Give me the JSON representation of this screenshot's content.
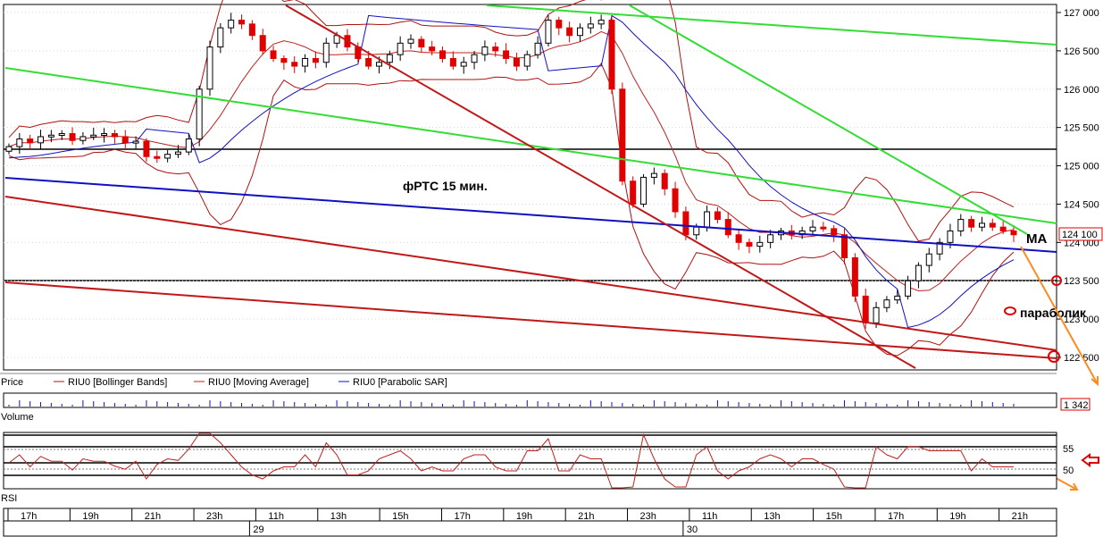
{
  "chart_data": {
    "type": "candlestick",
    "title": "фРТС   15 мин.",
    "instrument": "RIU0",
    "price_axis": {
      "ticks": [
        "127 000",
        "126 500",
        "126 000",
        "125 500",
        "125 000",
        "124 500",
        "124 000",
        "123 500",
        "123 000",
        "122 500"
      ],
      "ylim": [
        122350,
        127080
      ],
      "current_price": 124100,
      "current_price_label": "124 100"
    },
    "time_axis": {
      "hour_labels": [
        "17h",
        "19h",
        "21h",
        "23h",
        "11h",
        "13h",
        "15h",
        "17h",
        "19h",
        "21h",
        "23h",
        "11h",
        "13h",
        "15h",
        "17h",
        "19h",
        "21h"
      ],
      "day_labels": [
        {
          "label": "29",
          "after": "23h"
        },
        {
          "label": "30",
          "after": "23h"
        }
      ]
    },
    "price_panel": {
      "axis_name": "Price",
      "legend": [
        "RIU0 [Bollinger Bands]",
        "RIU0 [Moving Average]",
        "RIU0 [Parabolic SAR]"
      ],
      "close_series": [
        125250,
        125350,
        125300,
        125380,
        125400,
        125420,
        125330,
        125380,
        125400,
        125420,
        125380,
        125300,
        125320,
        125120,
        125100,
        125150,
        125180,
        125350,
        126000,
        126550,
        126800,
        126900,
        126850,
        126700,
        126500,
        126400,
        126350,
        126300,
        126400,
        126350,
        126600,
        126700,
        126550,
        126400,
        126300,
        126350,
        126450,
        126600,
        126650,
        126550,
        126500,
        126400,
        126300,
        126350,
        126450,
        126550,
        126500,
        126400,
        126300,
        126450,
        126600,
        126900,
        126800,
        126700,
        126800,
        126850,
        126900,
        126000,
        124800,
        124500,
        124850,
        124900,
        124700,
        124400,
        124100,
        124200,
        124400,
        124300,
        124100,
        124000,
        123950,
        124000,
        124100,
        124150,
        124100,
        124150,
        124200,
        124180,
        124100,
        123800,
        123300,
        122950,
        123150,
        123250,
        123300,
        123500,
        123700,
        123850,
        124000,
        124150,
        124300,
        124200,
        124250,
        124200,
        124150,
        124100
      ]
    },
    "volume_panel": {
      "axis_name": "Volume",
      "last_value": "1 342"
    },
    "rsi_panel": {
      "axis_name": "RSI",
      "ticks": [
        "55",
        "50"
      ],
      "levels": [
        55,
        50
      ]
    },
    "annotations": [
      "МА",
      "параболик"
    ]
  },
  "colors": {
    "bull_candle": "#ffffff",
    "bear_candle": "#e00000",
    "bollinger": "#b01010",
    "moving_average": "#c02020",
    "parabolic_sar": "#1010c0",
    "trend_green": "#33dd33",
    "trend_blue": "#1010c0",
    "trend_red": "#c01818",
    "arrow_orange": "#ff8a1e",
    "marker_red": "#e00000"
  }
}
